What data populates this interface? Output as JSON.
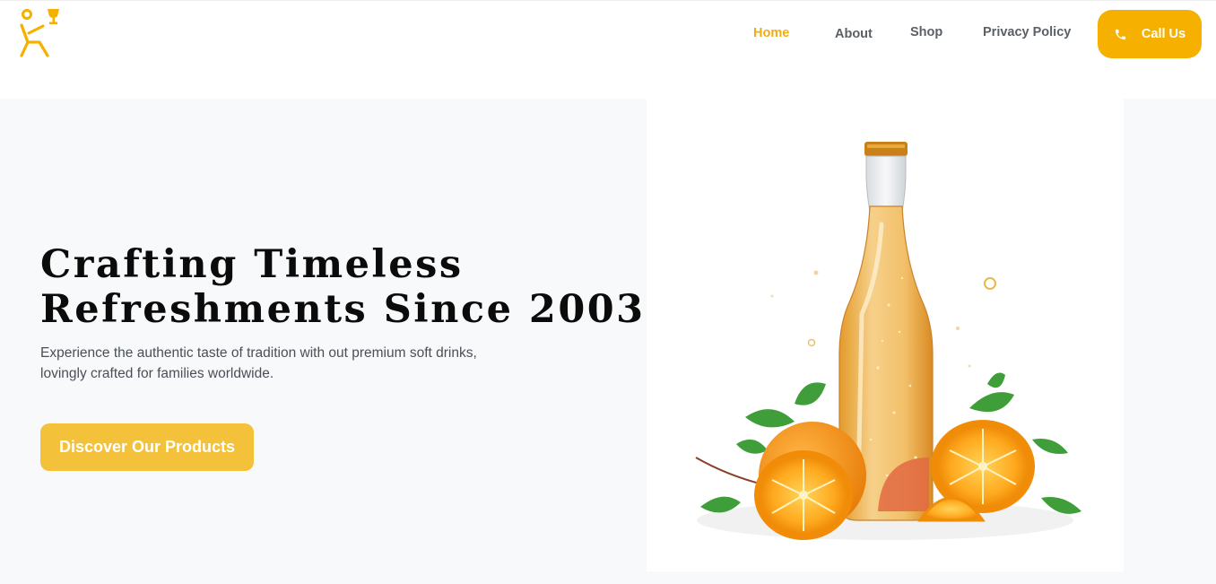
{
  "header": {
    "logo_icon": "seated-person-with-goblet-icon",
    "nav": [
      {
        "label": "Home",
        "active": true
      },
      {
        "label": "About",
        "active": false
      },
      {
        "label": "Shop",
        "active": false
      },
      {
        "label": "Privacy Policy",
        "active": false
      }
    ],
    "call_button": {
      "label": "Call Us",
      "icon": "phone-icon"
    }
  },
  "hero": {
    "title_line1": "Crafting Timeless",
    "title_line2": "Refreshments Since 2003",
    "subtitle_line1": "Experience the authentic taste of tradition with out premium soft drinks,",
    "subtitle_line2": "lovingly crafted for families worldwide.",
    "cta_label": "Discover Our Products",
    "image_alt": "orange-soda-bottle-with-orange-slices"
  },
  "colors": {
    "accent": "#f5b000",
    "cta": "#f3c23a",
    "active_nav": "#efae12",
    "nav_text": "#5b5f66",
    "hero_bg": "#f8f9fa"
  }
}
